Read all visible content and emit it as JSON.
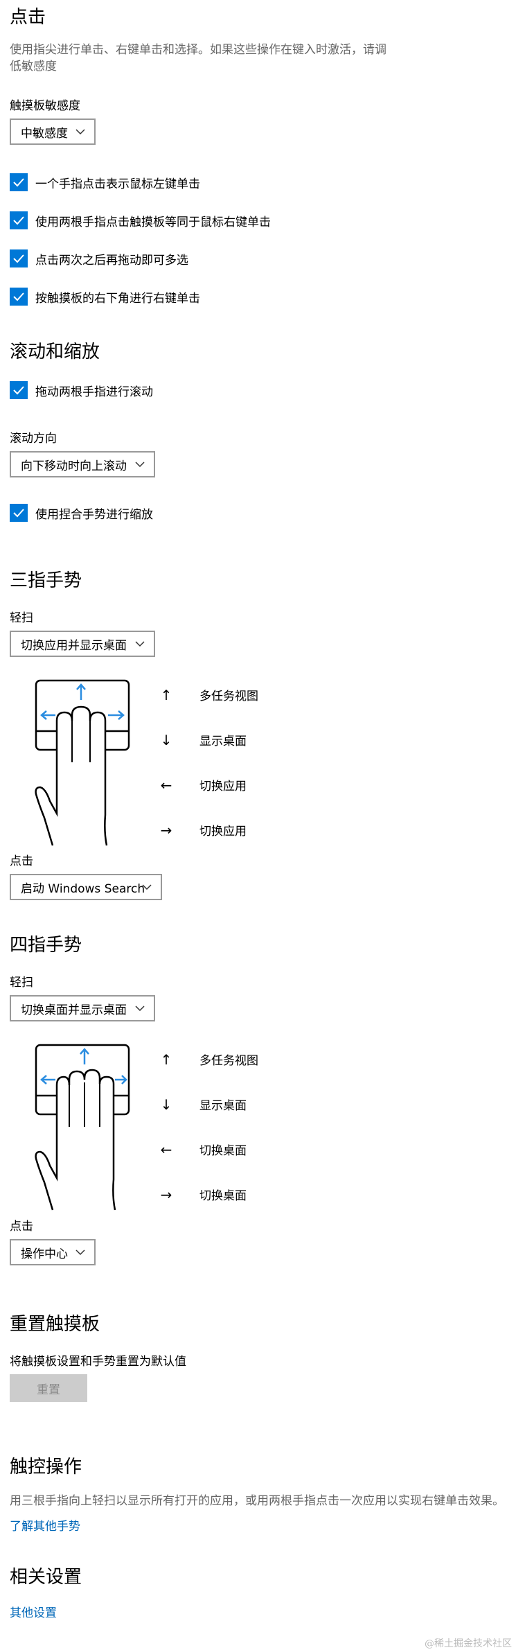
{
  "tap": {
    "title": "点击",
    "description_line1": "使用指尖进行单击、右键单击和选择。如果这些操作在键入时激活，请调",
    "description_line2": "低敏感度",
    "sensitivity_label": "触摸板敏感度",
    "sensitivity_value": "中敏感度",
    "checkboxes": [
      {
        "label": "一个手指点击表示鼠标左键单击",
        "checked": true
      },
      {
        "label": "使用两根手指点击触摸板等同于鼠标右键单击",
        "checked": true
      },
      {
        "label": "点击两次之后再拖动即可多选",
        "checked": true
      },
      {
        "label": "按触摸板的右下角进行右键单击",
        "checked": true
      }
    ]
  },
  "scroll_zoom": {
    "title": "滚动和缩放",
    "drag_two_fingers": "拖动两根手指进行滚动",
    "direction_label": "滚动方向",
    "direction_value": "向下移动时向上滚动",
    "pinch_zoom": "使用捏合手势进行缩放"
  },
  "three_finger": {
    "title": "三指手势",
    "swipe_label": "轻扫",
    "swipe_value": "切换应用并显示桌面",
    "gestures": [
      {
        "arrow": "↑",
        "action": "多任务视图"
      },
      {
        "arrow": "↓",
        "action": "显示桌面"
      },
      {
        "arrow": "←",
        "action": "切换应用"
      },
      {
        "arrow": "→",
        "action": "切换应用"
      }
    ],
    "tap_label": "点击",
    "tap_value": "启动 Windows Search"
  },
  "four_finger": {
    "title": "四指手势",
    "swipe_label": "轻扫",
    "swipe_value": "切换桌面并显示桌面",
    "gestures": [
      {
        "arrow": "↑",
        "action": "多任务视图"
      },
      {
        "arrow": "↓",
        "action": "显示桌面"
      },
      {
        "arrow": "←",
        "action": "切换桌面"
      },
      {
        "arrow": "→",
        "action": "切换桌面"
      }
    ],
    "tap_label": "点击",
    "tap_value": "操作中心"
  },
  "reset": {
    "title": "重置触摸板",
    "description": "将触摸板设置和手势重置为默认值",
    "button": "重置"
  },
  "touch_actions": {
    "title": "触控操作",
    "description": "用三根手指向上轻扫以显示所有打开的应用，或用两根手指点击一次应用以实现右键单击效果。",
    "link": "了解其他手势"
  },
  "related": {
    "title": "相关设置",
    "link": "其他设置"
  },
  "watermark": "@稀土掘金技术社区",
  "colors": {
    "accent": "#0078d7",
    "link": "#0067b8",
    "gesture_blue": "#2b8de0"
  }
}
